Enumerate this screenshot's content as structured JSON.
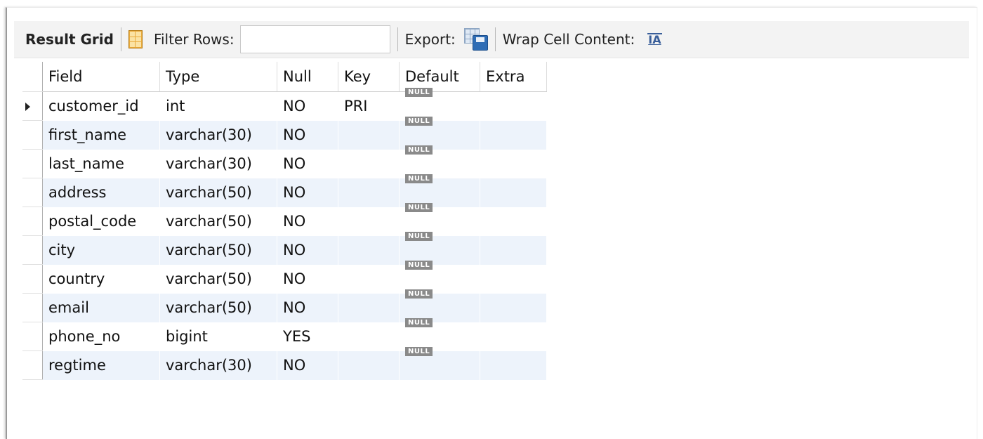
{
  "toolbar": {
    "title": "Result Grid",
    "filter_label": "Filter Rows:",
    "filter_value": "",
    "export_label": "Export:",
    "wrap_label": "Wrap Cell Content:",
    "wrap_icon_text": "IA"
  },
  "grid": {
    "columns": [
      "Field",
      "Type",
      "Null",
      "Key",
      "Default",
      "Extra"
    ],
    "rows": [
      {
        "field": "customer_id",
        "type": "int",
        "null": "NO",
        "key": "PRI",
        "default": "NULL",
        "extra": ""
      },
      {
        "field": "first_name",
        "type": "varchar(30)",
        "null": "NO",
        "key": "",
        "default": "NULL",
        "extra": ""
      },
      {
        "field": "last_name",
        "type": "varchar(30)",
        "null": "NO",
        "key": "",
        "default": "NULL",
        "extra": ""
      },
      {
        "field": "address",
        "type": "varchar(50)",
        "null": "NO",
        "key": "",
        "default": "NULL",
        "extra": ""
      },
      {
        "field": "postal_code",
        "type": "varchar(50)",
        "null": "NO",
        "key": "",
        "default": "NULL",
        "extra": ""
      },
      {
        "field": "city",
        "type": "varchar(50)",
        "null": "NO",
        "key": "",
        "default": "NULL",
        "extra": ""
      },
      {
        "field": "country",
        "type": "varchar(50)",
        "null": "NO",
        "key": "",
        "default": "NULL",
        "extra": ""
      },
      {
        "field": "email",
        "type": "varchar(50)",
        "null": "NO",
        "key": "",
        "default": "NULL",
        "extra": ""
      },
      {
        "field": "phone_no",
        "type": "bigint",
        "null": "YES",
        "key": "",
        "default": "NULL",
        "extra": ""
      },
      {
        "field": "regtime",
        "type": "varchar(30)",
        "null": "NO",
        "key": "",
        "default": "NULL",
        "extra": ""
      }
    ]
  },
  "icons": {
    "grid_view": "grid-view-icon",
    "export": "export-save-icon",
    "wrap": "wrap-text-icon",
    "row_pointer": "row-pointer-icon"
  },
  "colors": {
    "toolbar_bg": "#f3f3f3",
    "row_alt": "#edf3fb",
    "null_badge": "#8a8a8a"
  }
}
